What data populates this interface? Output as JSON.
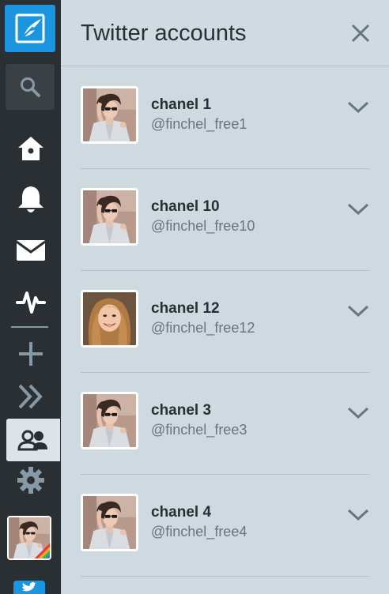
{
  "nav": {
    "items": [
      {
        "name": "compose",
        "icon": "compose-icon"
      },
      {
        "name": "search",
        "icon": "search-icon"
      },
      {
        "name": "home",
        "icon": "home-icon"
      },
      {
        "name": "notifications",
        "icon": "bell-icon"
      },
      {
        "name": "messages",
        "icon": "mail-icon"
      },
      {
        "name": "activity",
        "icon": "activity-icon"
      },
      {
        "name": "add-column",
        "icon": "plus-icon"
      },
      {
        "name": "expand",
        "icon": "double-chevron-right-icon"
      },
      {
        "name": "accounts",
        "icon": "accounts-icon"
      },
      {
        "name": "settings",
        "icon": "gear-icon"
      }
    ],
    "accent_color": "#1b95e0"
  },
  "panel": {
    "title": "Twitter accounts",
    "close_icon": "close-icon"
  },
  "accounts": [
    {
      "name": "chanel 1",
      "handle": "@finchel_free1",
      "avatar": "girl-sunglasses"
    },
    {
      "name": "chanel 10",
      "handle": "@finchel_free10",
      "avatar": "girl-sunglasses"
    },
    {
      "name": "chanel 12",
      "handle": "@finchel_free12",
      "avatar": "girl-smiling"
    },
    {
      "name": "chanel 3",
      "handle": "@finchel_free3",
      "avatar": "girl-sunglasses"
    },
    {
      "name": "chanel 4",
      "handle": "@finchel_free4",
      "avatar": "girl-sunglasses"
    }
  ]
}
